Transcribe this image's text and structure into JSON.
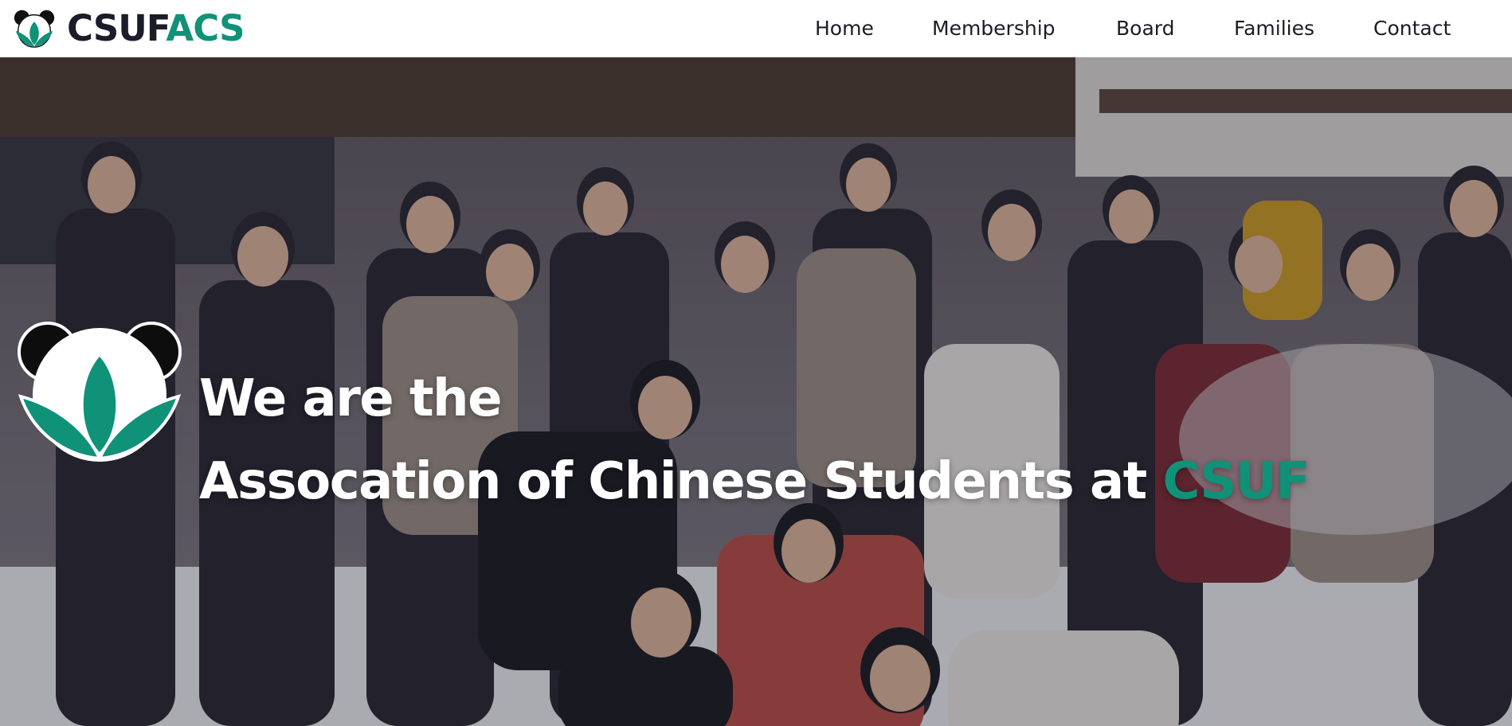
{
  "brand": {
    "name_part1": "CSUF",
    "name_part2": "ACS",
    "logo_icon": "panda-lotus-logo",
    "accent_color": "#0f9278",
    "dark_color": "#1b1b2a"
  },
  "nav": {
    "items": [
      {
        "label": "Home"
      },
      {
        "label": "Membership"
      },
      {
        "label": "Board"
      },
      {
        "label": "Families"
      },
      {
        "label": "Contact"
      }
    ]
  },
  "hero": {
    "line1": "We are the",
    "line2": "Assocation of Chinese Students at",
    "line2_accent": "CSUF",
    "background_image": "group-photo-of-students-in-snow",
    "logo_icon": "panda-lotus-logo"
  }
}
